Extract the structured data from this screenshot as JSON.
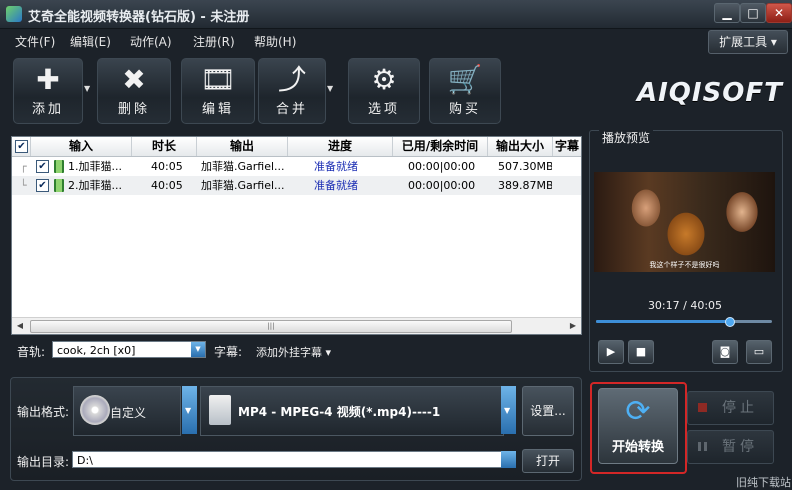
{
  "window": {
    "title": "艾奇全能视频转换器(钻石版) - 未注册",
    "buttons": {
      "minimize": "▁",
      "maximize": "□",
      "close": "✕"
    }
  },
  "menu": {
    "items": [
      "文件(F)",
      "编辑(E)",
      "动作(A)",
      "注册(R)",
      "帮助(H)"
    ],
    "extend_tools": "扩展工具 ▾"
  },
  "toolbar": {
    "add": {
      "label": "添加",
      "icon": "plus-icon"
    },
    "delete": {
      "label": "删除",
      "icon": "x-icon"
    },
    "edit": {
      "label": "编辑",
      "icon": "film-edit-icon"
    },
    "merge": {
      "label": "合并",
      "icon": "merge-arrow-icon"
    },
    "options": {
      "label": "选项",
      "icon": "gear-icon"
    },
    "buy": {
      "label": "购买",
      "icon": "cart-icon"
    },
    "logo": "AIQISOFT"
  },
  "filelist": {
    "columns": [
      "输入",
      "时长",
      "输出",
      "进度",
      "已用/剩余时间",
      "输出大小",
      "字幕"
    ],
    "rows": [
      {
        "input": "1.加菲猫...",
        "duration": "40:05",
        "output": "加菲猫.Garfiel...",
        "progress": "准备就绪",
        "time": "00:00|00:00",
        "size": "507.30MB"
      },
      {
        "input": "2.加菲猫...",
        "duration": "40:05",
        "output": "加菲猫.Garfiel...",
        "progress": "准备就绪",
        "time": "00:00|00:00",
        "size": "389.87MB"
      }
    ],
    "scroll_thumb": "|||"
  },
  "audio": {
    "label": "音轨:",
    "value": "cook, 2ch [x0]"
  },
  "subtitle": {
    "label": "字幕:",
    "value": "添加外挂字幕 ▾"
  },
  "output": {
    "format_label": "输出格式:",
    "preset": "自定义",
    "format": "MP4 - MPEG-4 视频(*.mp4)----1",
    "settings": "设置...",
    "dir_label": "输出目录:",
    "dir_value": "D:\\",
    "open": "打开"
  },
  "preview": {
    "title": "播放预览",
    "subtitle_text": "我这个样子不是很好吗",
    "time": "30:17 / 40:05",
    "progress": 0.755
  },
  "controls": {
    "start": "开始转换",
    "stop": "停止",
    "pause": "暂停"
  },
  "watermark": "旧纯下载站"
}
